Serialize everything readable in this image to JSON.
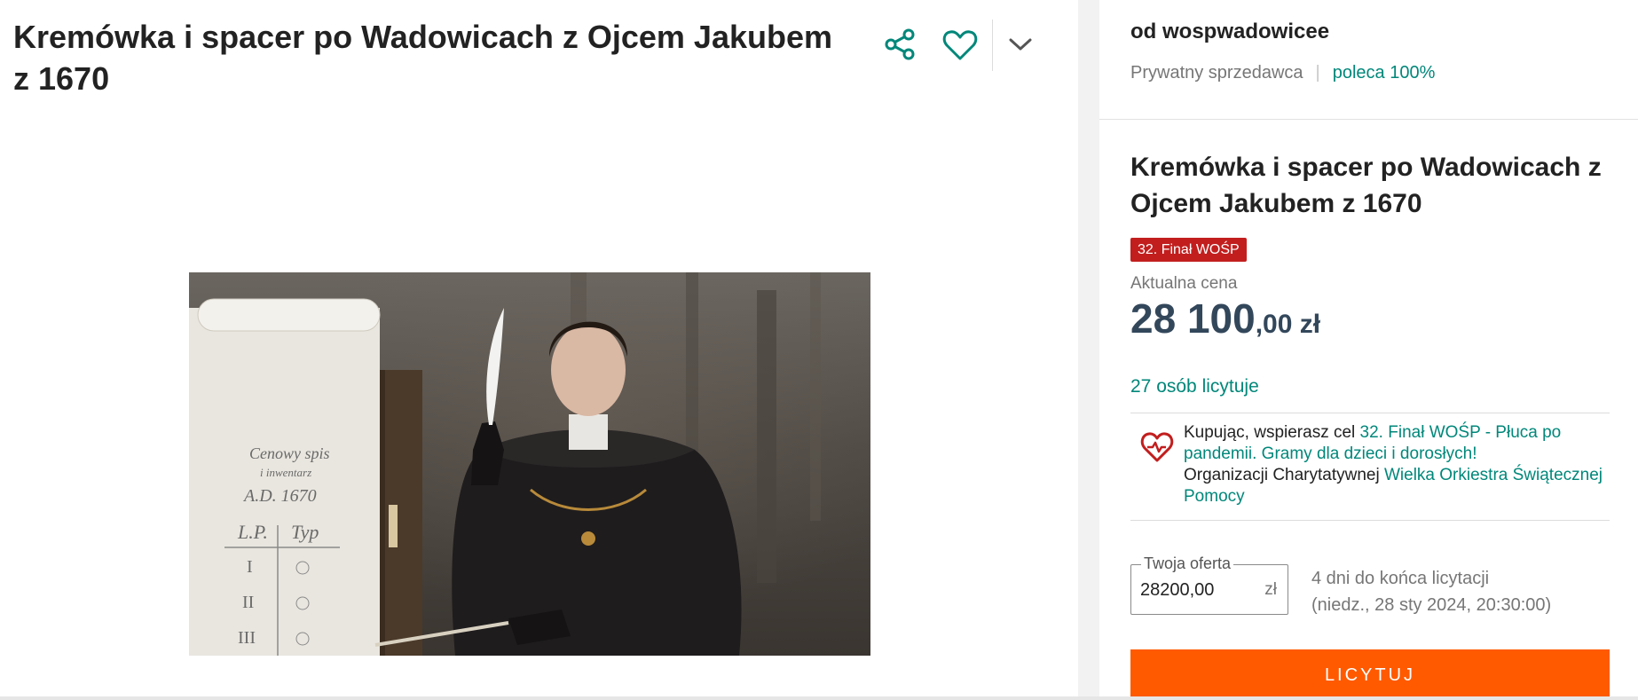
{
  "listing": {
    "title": "Kremówka i spacer po Wadowicach z Ojcem Jakubem z 1670"
  },
  "actions": {
    "share_icon": "share-icon",
    "favorite_icon": "heart-icon",
    "more_icon": "chevron-down-icon"
  },
  "photo": {
    "scroll_title": "Cenowy spis",
    "scroll_subtitle": "i inwentarz",
    "scroll_date": "A.D. 1670",
    "col_lp": "L.P.",
    "col_typ": "Typ",
    "rows": [
      "I",
      "II",
      "III"
    ]
  },
  "seller": {
    "name": "od wospwadowicee",
    "type": "Prywatny sprzedawca",
    "recommend": "poleca 100%"
  },
  "offer": {
    "title": "Kremówka i spacer po Wadowicach z Ojcem Jakubem z 1670",
    "badge": "32. Finał WOŚP",
    "price_label": "Aktualna cena",
    "price_main": "28 100",
    "price_decimal": ",00 zł",
    "bidders": "27 osób licytuje",
    "charity": {
      "icon": "heart-pulse-icon",
      "text1": "Kupując, wspierasz cel ",
      "link1": "32. Finał WOŚP - Płuca po pandemii. Gramy dla dzieci i dorosłych!",
      "text2": "Organizacji Charytatywnej ",
      "link2": "Wielka Orkiestra Świątecznej Pomocy"
    },
    "bid_label": "Twoja oferta",
    "bid_value": "28200,00",
    "bid_currency": "zł",
    "ends_line1": "4 dni do końca licytacji",
    "ends_line2": "(niedz., 28 sty 2024, 20:30:00)",
    "bid_button": "LICYTUJ"
  },
  "colors": {
    "accent": "#00877a",
    "badge": "#c21e1e",
    "button": "#ff5a00",
    "price": "#33475b"
  }
}
